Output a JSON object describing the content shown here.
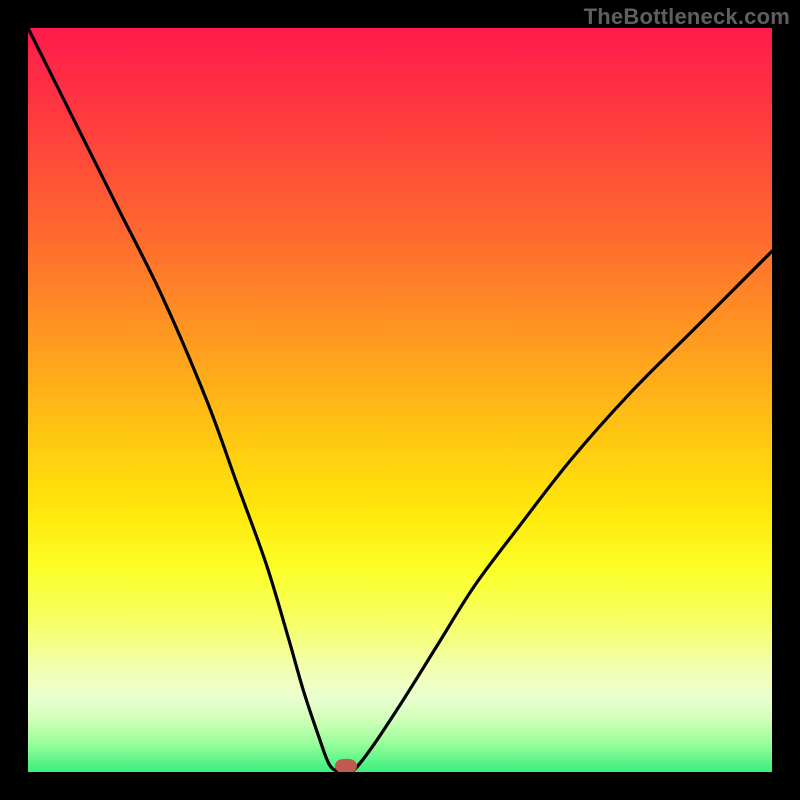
{
  "watermark": "TheBottleneck.com",
  "colors": {
    "frame": "#000000",
    "curve": "#000000",
    "marker": "#c05a50",
    "gradient_top": "#ff1a4b",
    "gradient_bottom": "#39ef7e"
  },
  "chart_data": {
    "type": "line",
    "title": "",
    "xlabel": "",
    "ylabel": "",
    "xlim": [
      0,
      100
    ],
    "ylim": [
      0,
      100
    ],
    "grid": false,
    "series": [
      {
        "name": "bottleneck-curve",
        "x": [
          0,
          6,
          12,
          18,
          24,
          28,
          32,
          35,
          37,
          39,
          40.5,
          42,
          43.5,
          46,
          50,
          55,
          60,
          66,
          73,
          81,
          90,
          100
        ],
        "values": [
          100,
          88,
          76,
          64,
          50,
          39,
          28,
          18,
          11,
          5,
          1,
          0,
          0,
          3,
          9,
          17,
          25,
          33,
          42,
          51,
          60,
          70
        ]
      }
    ],
    "annotations": [
      {
        "name": "minimum-marker",
        "x": 42.7,
        "y": 0.8
      }
    ]
  }
}
